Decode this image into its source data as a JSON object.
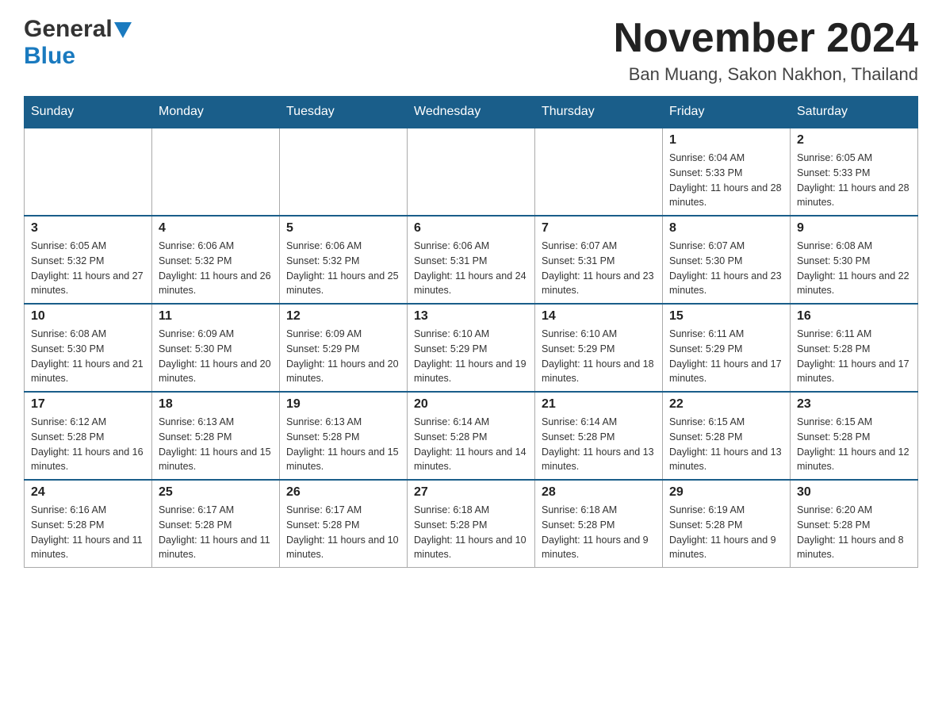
{
  "header": {
    "logo_general": "General",
    "logo_blue": "Blue",
    "title": "November 2024",
    "subtitle": "Ban Muang, Sakon Nakhon, Thailand"
  },
  "weekdays": [
    "Sunday",
    "Monday",
    "Tuesday",
    "Wednesday",
    "Thursday",
    "Friday",
    "Saturday"
  ],
  "weeks": [
    [
      {
        "day": "",
        "info": ""
      },
      {
        "day": "",
        "info": ""
      },
      {
        "day": "",
        "info": ""
      },
      {
        "day": "",
        "info": ""
      },
      {
        "day": "",
        "info": ""
      },
      {
        "day": "1",
        "info": "Sunrise: 6:04 AM\nSunset: 5:33 PM\nDaylight: 11 hours and 28 minutes."
      },
      {
        "day": "2",
        "info": "Sunrise: 6:05 AM\nSunset: 5:33 PM\nDaylight: 11 hours and 28 minutes."
      }
    ],
    [
      {
        "day": "3",
        "info": "Sunrise: 6:05 AM\nSunset: 5:32 PM\nDaylight: 11 hours and 27 minutes."
      },
      {
        "day": "4",
        "info": "Sunrise: 6:06 AM\nSunset: 5:32 PM\nDaylight: 11 hours and 26 minutes."
      },
      {
        "day": "5",
        "info": "Sunrise: 6:06 AM\nSunset: 5:32 PM\nDaylight: 11 hours and 25 minutes."
      },
      {
        "day": "6",
        "info": "Sunrise: 6:06 AM\nSunset: 5:31 PM\nDaylight: 11 hours and 24 minutes."
      },
      {
        "day": "7",
        "info": "Sunrise: 6:07 AM\nSunset: 5:31 PM\nDaylight: 11 hours and 23 minutes."
      },
      {
        "day": "8",
        "info": "Sunrise: 6:07 AM\nSunset: 5:30 PM\nDaylight: 11 hours and 23 minutes."
      },
      {
        "day": "9",
        "info": "Sunrise: 6:08 AM\nSunset: 5:30 PM\nDaylight: 11 hours and 22 minutes."
      }
    ],
    [
      {
        "day": "10",
        "info": "Sunrise: 6:08 AM\nSunset: 5:30 PM\nDaylight: 11 hours and 21 minutes."
      },
      {
        "day": "11",
        "info": "Sunrise: 6:09 AM\nSunset: 5:30 PM\nDaylight: 11 hours and 20 minutes."
      },
      {
        "day": "12",
        "info": "Sunrise: 6:09 AM\nSunset: 5:29 PM\nDaylight: 11 hours and 20 minutes."
      },
      {
        "day": "13",
        "info": "Sunrise: 6:10 AM\nSunset: 5:29 PM\nDaylight: 11 hours and 19 minutes."
      },
      {
        "day": "14",
        "info": "Sunrise: 6:10 AM\nSunset: 5:29 PM\nDaylight: 11 hours and 18 minutes."
      },
      {
        "day": "15",
        "info": "Sunrise: 6:11 AM\nSunset: 5:29 PM\nDaylight: 11 hours and 17 minutes."
      },
      {
        "day": "16",
        "info": "Sunrise: 6:11 AM\nSunset: 5:28 PM\nDaylight: 11 hours and 17 minutes."
      }
    ],
    [
      {
        "day": "17",
        "info": "Sunrise: 6:12 AM\nSunset: 5:28 PM\nDaylight: 11 hours and 16 minutes."
      },
      {
        "day": "18",
        "info": "Sunrise: 6:13 AM\nSunset: 5:28 PM\nDaylight: 11 hours and 15 minutes."
      },
      {
        "day": "19",
        "info": "Sunrise: 6:13 AM\nSunset: 5:28 PM\nDaylight: 11 hours and 15 minutes."
      },
      {
        "day": "20",
        "info": "Sunrise: 6:14 AM\nSunset: 5:28 PM\nDaylight: 11 hours and 14 minutes."
      },
      {
        "day": "21",
        "info": "Sunrise: 6:14 AM\nSunset: 5:28 PM\nDaylight: 11 hours and 13 minutes."
      },
      {
        "day": "22",
        "info": "Sunrise: 6:15 AM\nSunset: 5:28 PM\nDaylight: 11 hours and 13 minutes."
      },
      {
        "day": "23",
        "info": "Sunrise: 6:15 AM\nSunset: 5:28 PM\nDaylight: 11 hours and 12 minutes."
      }
    ],
    [
      {
        "day": "24",
        "info": "Sunrise: 6:16 AM\nSunset: 5:28 PM\nDaylight: 11 hours and 11 minutes."
      },
      {
        "day": "25",
        "info": "Sunrise: 6:17 AM\nSunset: 5:28 PM\nDaylight: 11 hours and 11 minutes."
      },
      {
        "day": "26",
        "info": "Sunrise: 6:17 AM\nSunset: 5:28 PM\nDaylight: 11 hours and 10 minutes."
      },
      {
        "day": "27",
        "info": "Sunrise: 6:18 AM\nSunset: 5:28 PM\nDaylight: 11 hours and 10 minutes."
      },
      {
        "day": "28",
        "info": "Sunrise: 6:18 AM\nSunset: 5:28 PM\nDaylight: 11 hours and 9 minutes."
      },
      {
        "day": "29",
        "info": "Sunrise: 6:19 AM\nSunset: 5:28 PM\nDaylight: 11 hours and 9 minutes."
      },
      {
        "day": "30",
        "info": "Sunrise: 6:20 AM\nSunset: 5:28 PM\nDaylight: 11 hours and 8 minutes."
      }
    ]
  ]
}
